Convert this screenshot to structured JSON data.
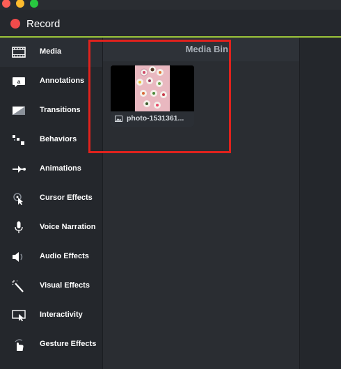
{
  "window": {
    "traffic_lights": [
      "close",
      "minimize",
      "zoom"
    ]
  },
  "header": {
    "record_label": "Record",
    "accent_color": "#9bc43a",
    "record_color": "#ef4b4b"
  },
  "sidebar": {
    "items": [
      {
        "label": "Media",
        "icon": "film-icon",
        "active": true
      },
      {
        "label": "Annotations",
        "icon": "annotation-icon"
      },
      {
        "label": "Transitions",
        "icon": "transition-icon"
      },
      {
        "label": "Behaviors",
        "icon": "behaviors-icon"
      },
      {
        "label": "Animations",
        "icon": "animation-arrow-icon"
      },
      {
        "label": "Cursor Effects",
        "icon": "cursor-icon"
      },
      {
        "label": "Voice Narration",
        "icon": "microphone-icon"
      },
      {
        "label": "Audio Effects",
        "icon": "speaker-icon"
      },
      {
        "label": "Visual Effects",
        "icon": "magic-wand-icon"
      },
      {
        "label": "Interactivity",
        "icon": "interactivity-icon"
      },
      {
        "label": "Gesture Effects",
        "icon": "hand-gesture-icon"
      }
    ]
  },
  "media_bin": {
    "title": "Media Bin",
    "items": [
      {
        "name": "photo-1531361...",
        "type_icon": "image-icon"
      }
    ]
  },
  "highlight_color": "#e0221d"
}
